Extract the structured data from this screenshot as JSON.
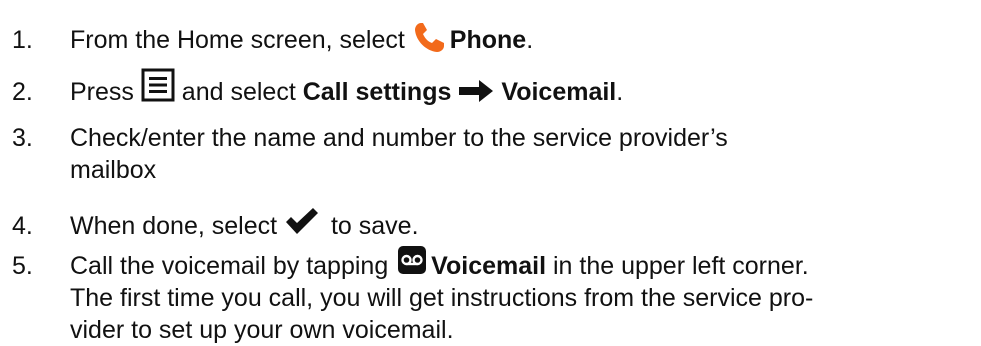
{
  "steps": [
    {
      "number": "1.",
      "before": "From the Home screen, select ",
      "icon": "phone-icon",
      "bold": "Phone",
      "after": "."
    },
    {
      "number": "2.",
      "before": "Press ",
      "icon": "menu-icon",
      "middle": " and select ",
      "bold1": "Call settings",
      "arrow_icon": "arrow-right-icon",
      "bold2": "Voicemail",
      "after": "."
    },
    {
      "number": "3.",
      "line1": "Check/enter the name and number to the service provider’s",
      "line2": "mailbox"
    },
    {
      "number": "4.",
      "before": "When done, select ",
      "icon": "checkmark-icon",
      "after": " to save."
    },
    {
      "number": "5.",
      "before": "Call the voicemail by tapping ",
      "icon": "voicemail-icon",
      "bold": "Voicemail",
      "after": " in the upper left corner.",
      "line2": "The first time you call, you will get instructions from the service pro-",
      "line3": "vider to set up your own voicemail."
    }
  ],
  "colors": {
    "phone_icon": "#f26a1b",
    "text": "#111111"
  }
}
